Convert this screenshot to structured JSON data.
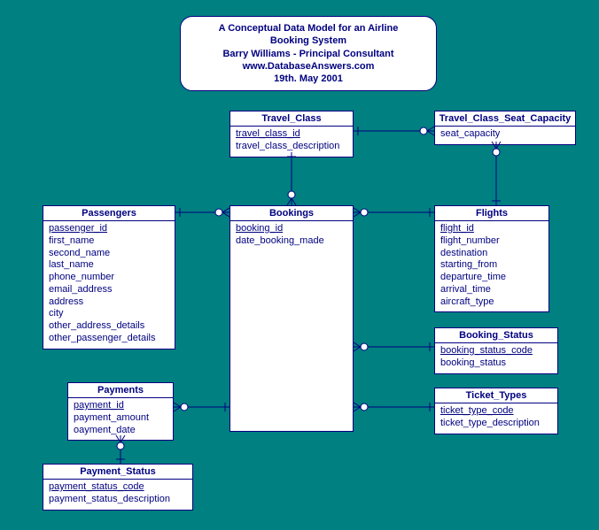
{
  "title": {
    "line1": "A Conceptual Data Model for an Airline Booking System",
    "line2": "Barry Williams - Principal Consultant",
    "line3": "www.DatabaseAnswers.com",
    "line4": "19th. May 2001"
  },
  "entities": {
    "travel_class": {
      "name": "Travel_Class",
      "pk": "travel_class_id",
      "attrs": [
        "travel_class_description"
      ]
    },
    "travel_class_seat_capacity": {
      "name": "Travel_Class_Seat_Capacity",
      "attrs": [
        "seat_capacity"
      ]
    },
    "passengers": {
      "name": "Passengers",
      "pk": "passenger_id",
      "attrs": [
        "first_name",
        "second_name",
        "last_name",
        "phone_number",
        "email_address",
        "address",
        "city",
        "other_address_details",
        "other_passenger_details"
      ]
    },
    "bookings": {
      "name": "Bookings",
      "pk": "booking_id",
      "attrs": [
        "date_booking_made"
      ]
    },
    "flights": {
      "name": "Flights",
      "pk": "flight_id",
      "attrs": [
        "flight_number",
        "destination",
        "starting_from",
        "departure_time",
        "arrival_time",
        "aircraft_type"
      ]
    },
    "booking_status": {
      "name": "Booking_Status",
      "pk": "booking_status_code",
      "attrs": [
        "booking_status"
      ]
    },
    "ticket_types": {
      "name": "Ticket_Types",
      "pk": "ticket_type_code",
      "attrs": [
        "ticket_type_description"
      ]
    },
    "payments": {
      "name": "Payments",
      "pk": "payment_id",
      "attrs": [
        "payment_amount",
        "oayment_date"
      ]
    },
    "payment_status": {
      "name": "Payment_Status",
      "pk": "payment_status_code",
      "attrs": [
        "payment_status_description"
      ]
    }
  },
  "relationships": [
    {
      "from": "Travel_Class",
      "to": "Travel_Class_Seat_Capacity",
      "type": "one-to-many"
    },
    {
      "from": "Travel_Class",
      "to": "Bookings",
      "type": "one-to-many"
    },
    {
      "from": "Flights",
      "to": "Travel_Class_Seat_Capacity",
      "type": "one-to-many"
    },
    {
      "from": "Passengers",
      "to": "Bookings",
      "type": "one-to-many"
    },
    {
      "from": "Flights",
      "to": "Bookings",
      "type": "one-to-many"
    },
    {
      "from": "Booking_Status",
      "to": "Bookings",
      "type": "one-to-many"
    },
    {
      "from": "Ticket_Types",
      "to": "Bookings",
      "type": "one-to-many"
    },
    {
      "from": "Bookings",
      "to": "Payments",
      "type": "one-to-many"
    },
    {
      "from": "Payment_Status",
      "to": "Payments",
      "type": "one-to-many"
    }
  ]
}
